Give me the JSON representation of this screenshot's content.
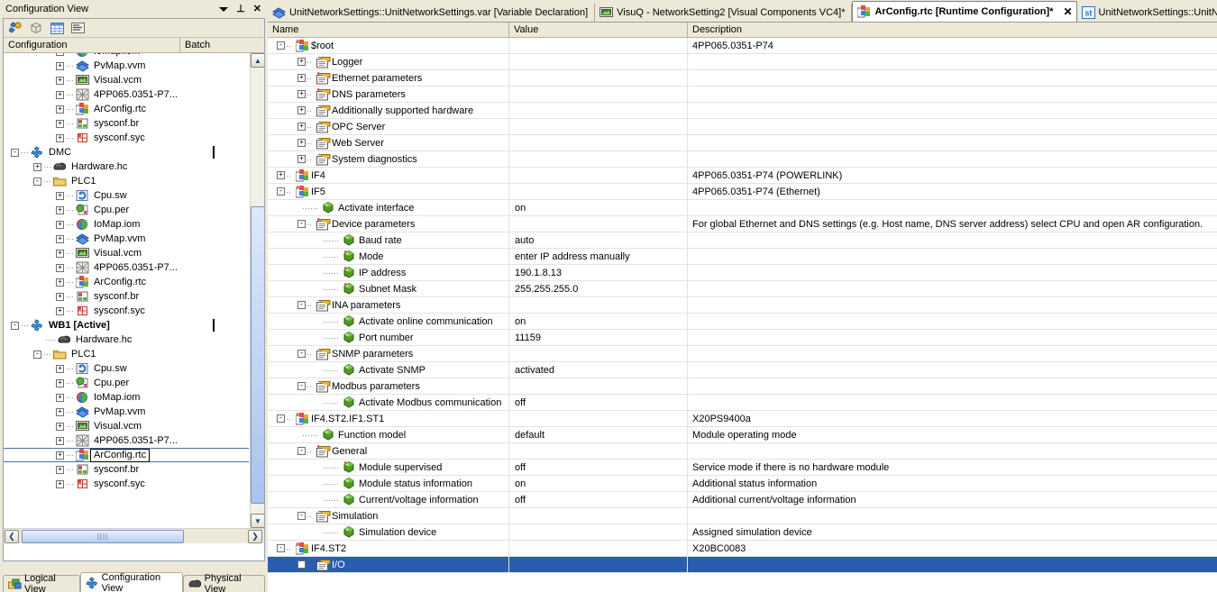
{
  "dock": {
    "title": "Configuration View",
    "window_buttons": [
      {
        "name": "dropdown-icon",
        "glyph": "▼"
      },
      {
        "name": "pin-icon",
        "glyph": "⊥"
      },
      {
        "name": "close-icon",
        "glyph": "✕"
      }
    ],
    "toolbar": [
      {
        "name": "configuration-icon"
      },
      {
        "name": "package-icon"
      },
      {
        "name": "table-icon"
      },
      {
        "name": "properties-icon"
      }
    ],
    "columns": [
      "Configuration",
      "Batch"
    ],
    "tree": [
      {
        "indent": 2,
        "expander": "+",
        "icon": "iomap",
        "label": "IoMap.iom",
        "bold": false,
        "checkbox": false
      },
      {
        "indent": 2,
        "expander": "+",
        "icon": "pvmap",
        "label": "PvMap.vvm",
        "bold": false,
        "checkbox": false
      },
      {
        "indent": 2,
        "expander": "+",
        "icon": "visual",
        "label": "Visual.vcm",
        "bold": false,
        "checkbox": false
      },
      {
        "indent": 2,
        "expander": "+",
        "icon": "hw",
        "label": "4PP065.0351-P7...",
        "bold": false,
        "checkbox": false
      },
      {
        "indent": 2,
        "expander": "+",
        "icon": "arconfig",
        "label": "ArConfig.rtc",
        "bold": false,
        "checkbox": false
      },
      {
        "indent": 2,
        "expander": "+",
        "icon": "sysconfbr",
        "label": "sysconf.br",
        "bold": false,
        "checkbox": false
      },
      {
        "indent": 2,
        "expander": "+",
        "icon": "sysconfsyc",
        "label": "sysconf.syc",
        "bold": false,
        "checkbox": false
      },
      {
        "indent": 0,
        "expander": "-",
        "icon": "config",
        "label": "DMC",
        "bold": false,
        "checkbox": true
      },
      {
        "indent": 1,
        "expander": "+",
        "icon": "hardware",
        "label": "Hardware.hc",
        "bold": false,
        "checkbox": false
      },
      {
        "indent": 1,
        "expander": "-",
        "icon": "folder",
        "label": "PLC1",
        "bold": false,
        "checkbox": false
      },
      {
        "indent": 2,
        "expander": "+",
        "icon": "cpusw",
        "label": "Cpu.sw",
        "bold": false,
        "checkbox": false
      },
      {
        "indent": 2,
        "expander": "+",
        "icon": "cpuper",
        "label": "Cpu.per",
        "bold": false,
        "checkbox": false
      },
      {
        "indent": 2,
        "expander": "+",
        "icon": "iomap",
        "label": "IoMap.iom",
        "bold": false,
        "checkbox": false
      },
      {
        "indent": 2,
        "expander": "+",
        "icon": "pvmap",
        "label": "PvMap.vvm",
        "bold": false,
        "checkbox": false
      },
      {
        "indent": 2,
        "expander": "+",
        "icon": "visual",
        "label": "Visual.vcm",
        "bold": false,
        "checkbox": false
      },
      {
        "indent": 2,
        "expander": "+",
        "icon": "hw",
        "label": "4PP065.0351-P7...",
        "bold": false,
        "checkbox": false
      },
      {
        "indent": 2,
        "expander": "+",
        "icon": "arconfig",
        "label": "ArConfig.rtc",
        "bold": false,
        "checkbox": false
      },
      {
        "indent": 2,
        "expander": "+",
        "icon": "sysconfbr",
        "label": "sysconf.br",
        "bold": false,
        "checkbox": false
      },
      {
        "indent": 2,
        "expander": "+",
        "icon": "sysconfsyc",
        "label": "sysconf.syc",
        "bold": false,
        "checkbox": false
      },
      {
        "indent": 0,
        "expander": "-",
        "icon": "config",
        "label": "WB1 [Active]",
        "bold": true,
        "checkbox": true
      },
      {
        "indent": 1,
        "expander": "",
        "icon": "hardware",
        "label": "Hardware.hc",
        "bold": false,
        "checkbox": false
      },
      {
        "indent": 1,
        "expander": "-",
        "icon": "folder",
        "label": "PLC1",
        "bold": false,
        "checkbox": false
      },
      {
        "indent": 2,
        "expander": "+",
        "icon": "cpusw",
        "label": "Cpu.sw",
        "bold": false,
        "checkbox": false
      },
      {
        "indent": 2,
        "expander": "+",
        "icon": "cpuper",
        "label": "Cpu.per",
        "bold": false,
        "checkbox": false
      },
      {
        "indent": 2,
        "expander": "+",
        "icon": "iomap",
        "label": "IoMap.iom",
        "bold": false,
        "checkbox": false
      },
      {
        "indent": 2,
        "expander": "+",
        "icon": "pvmap",
        "label": "PvMap.vvm",
        "bold": false,
        "checkbox": false
      },
      {
        "indent": 2,
        "expander": "+",
        "icon": "visual",
        "label": "Visual.vcm",
        "bold": false,
        "checkbox": false
      },
      {
        "indent": 2,
        "expander": "+",
        "icon": "hw",
        "label": "4PP065.0351-P7...",
        "bold": false,
        "checkbox": false
      },
      {
        "indent": 2,
        "expander": "+",
        "icon": "arconfig",
        "label": "ArConfig.rtc",
        "bold": false,
        "checkbox": false,
        "selected": true,
        "editing": true
      },
      {
        "indent": 2,
        "expander": "+",
        "icon": "sysconfbr",
        "label": "sysconf.br",
        "bold": false,
        "checkbox": false
      },
      {
        "indent": 2,
        "expander": "+",
        "icon": "sysconfsyc",
        "label": "sysconf.syc",
        "bold": false,
        "checkbox": false
      }
    ],
    "hscroll": {
      "left_glyph": "❮",
      "right_glyph": "❯",
      "thumb_glyph": "||||"
    },
    "vscroll": {
      "up_glyph": "▲",
      "down_glyph": "▼"
    },
    "view_tabs": [
      {
        "label": "Logical View",
        "icon": "logical-view-icon",
        "active": false
      },
      {
        "label": "Configuration View",
        "icon": "configuration-view-icon",
        "active": true
      },
      {
        "label": "Physical View",
        "icon": "physical-view-icon",
        "active": false
      }
    ]
  },
  "editor": {
    "tabs": [
      {
        "label": "UnitNetworkSettings::UnitNetworkSettings.var [Variable Declaration]",
        "icon": "variable-declaration-icon",
        "active": false,
        "closable": false
      },
      {
        "label": "VisuQ - NetworkSetting2 [Visual Components VC4]*",
        "icon": "visual-components-icon",
        "active": false,
        "closable": false
      },
      {
        "label": "ArConfig.rtc [Runtime Configuration]*",
        "icon": "runtime-configuration-icon",
        "active": true,
        "closable": true,
        "close_glyph": "✕"
      },
      {
        "label": "UnitNetworkSettings::UnitN",
        "icon": "structure-icon",
        "active": false,
        "closable": false
      }
    ],
    "columns": [
      "Name",
      "Value",
      "Description"
    ],
    "rows": [
      {
        "indent": 0,
        "expander": "-",
        "bang": true,
        "icon": "config",
        "name": "$root",
        "value": "",
        "desc": "4PP065.0351-P74"
      },
      {
        "indent": 1,
        "expander": "+",
        "bang": false,
        "icon": "page",
        "name": "Logger",
        "value": "",
        "desc": ""
      },
      {
        "indent": 1,
        "expander": "+",
        "bang": true,
        "icon": "page",
        "name": "Ethernet parameters",
        "value": "",
        "desc": ""
      },
      {
        "indent": 1,
        "expander": "+",
        "bang": true,
        "icon": "page",
        "name": "DNS parameters",
        "value": "",
        "desc": ""
      },
      {
        "indent": 1,
        "expander": "+",
        "bang": false,
        "icon": "page",
        "name": "Additionally supported hardware",
        "value": "",
        "desc": ""
      },
      {
        "indent": 1,
        "expander": "+",
        "bang": false,
        "icon": "page",
        "name": "OPC Server",
        "value": "",
        "desc": ""
      },
      {
        "indent": 1,
        "expander": "+",
        "bang": false,
        "icon": "page",
        "name": "Web Server",
        "value": "",
        "desc": ""
      },
      {
        "indent": 1,
        "expander": "+",
        "bang": false,
        "icon": "page",
        "name": "System diagnostics",
        "value": "",
        "desc": ""
      },
      {
        "indent": 0,
        "expander": "+",
        "bang": false,
        "icon": "config",
        "name": "IF4",
        "value": "",
        "desc": "4PP065.0351-P74 (POWERLINK)"
      },
      {
        "indent": 0,
        "expander": "-",
        "bang": true,
        "icon": "config",
        "name": "IF5",
        "value": "",
        "desc": "4PP065.0351-P74 (Ethernet)"
      },
      {
        "indent": 1,
        "expander": "",
        "bang": false,
        "icon": "gem",
        "name": "Activate interface",
        "value": "on",
        "desc": ""
      },
      {
        "indent": 1,
        "expander": "-",
        "bang": true,
        "icon": "page",
        "name": "Device parameters",
        "value": "",
        "desc": "For global Ethernet and DNS settings (e.g. Host name, DNS server address) select CPU and open AR configuration."
      },
      {
        "indent": 2,
        "expander": "",
        "bang": false,
        "icon": "gem",
        "name": "Baud rate",
        "value": "auto",
        "desc": ""
      },
      {
        "indent": 2,
        "expander": "",
        "bang": true,
        "icon": "gem",
        "name": "Mode",
        "value": "enter IP address manually",
        "desc": ""
      },
      {
        "indent": 2,
        "expander": "",
        "bang": true,
        "icon": "gem",
        "name": "IP address",
        "value": "190.1.8.13",
        "desc": ""
      },
      {
        "indent": 2,
        "expander": "",
        "bang": true,
        "icon": "gem",
        "name": "Subnet Mask",
        "value": "255.255.255.0",
        "desc": ""
      },
      {
        "indent": 1,
        "expander": "-",
        "bang": false,
        "icon": "page",
        "name": "INA parameters",
        "value": "",
        "desc": ""
      },
      {
        "indent": 2,
        "expander": "",
        "bang": false,
        "icon": "gem",
        "name": "Activate online communication",
        "value": "on",
        "desc": ""
      },
      {
        "indent": 2,
        "expander": "",
        "bang": false,
        "icon": "gem",
        "name": "Port number",
        "value": "11159",
        "desc": ""
      },
      {
        "indent": 1,
        "expander": "-",
        "bang": false,
        "icon": "page",
        "name": "SNMP parameters",
        "value": "",
        "desc": ""
      },
      {
        "indent": 2,
        "expander": "",
        "bang": false,
        "icon": "gem",
        "name": "Activate SNMP",
        "value": "activated",
        "desc": ""
      },
      {
        "indent": 1,
        "expander": "-",
        "bang": false,
        "icon": "page",
        "name": "Modbus parameters",
        "value": "",
        "desc": ""
      },
      {
        "indent": 2,
        "expander": "",
        "bang": false,
        "icon": "gem",
        "name": "Activate Modbus communication",
        "value": "off",
        "desc": ""
      },
      {
        "indent": 0,
        "expander": "-",
        "bang": true,
        "icon": "config",
        "name": "IF4.ST2.IF1.ST1",
        "value": "",
        "desc": "X20PS9400a"
      },
      {
        "indent": 1,
        "expander": "",
        "bang": false,
        "icon": "gem",
        "name": "Function model",
        "value": "default",
        "desc": "Module operating mode"
      },
      {
        "indent": 1,
        "expander": "-",
        "bang": true,
        "icon": "page",
        "name": "General",
        "value": "",
        "desc": ""
      },
      {
        "indent": 2,
        "expander": "",
        "bang": true,
        "icon": "gem",
        "name": "Module supervised",
        "value": "off",
        "desc": "Service mode if there is no hardware module"
      },
      {
        "indent": 2,
        "expander": "",
        "bang": false,
        "icon": "gem",
        "name": "Module status information",
        "value": "on",
        "desc": "Additional status information"
      },
      {
        "indent": 2,
        "expander": "",
        "bang": false,
        "icon": "gem",
        "name": "Current/voltage information",
        "value": "off",
        "desc": "Additional current/voltage information"
      },
      {
        "indent": 1,
        "expander": "-",
        "bang": false,
        "icon": "page",
        "name": "Simulation",
        "value": "",
        "desc": ""
      },
      {
        "indent": 2,
        "expander": "",
        "bang": false,
        "icon": "gem",
        "name": "Simulation device",
        "value": "",
        "desc": "Assigned simulation device"
      },
      {
        "indent": 0,
        "expander": "-",
        "bang": true,
        "icon": "config",
        "name": "IF4.ST2",
        "value": "",
        "desc": "X20BC0083"
      },
      {
        "indent": 1,
        "expander": "-",
        "bang": false,
        "icon": "page",
        "name": "I/O",
        "value": "",
        "desc": "",
        "selected": true
      }
    ]
  },
  "colors": {
    "chrome": "#ece9d8",
    "selection": "#2a5db0",
    "grid_line": "#e3e3e3",
    "gem_green": "#4e9a22",
    "error_red": "#c00000",
    "tree_select_border": "#4a6fa5"
  }
}
